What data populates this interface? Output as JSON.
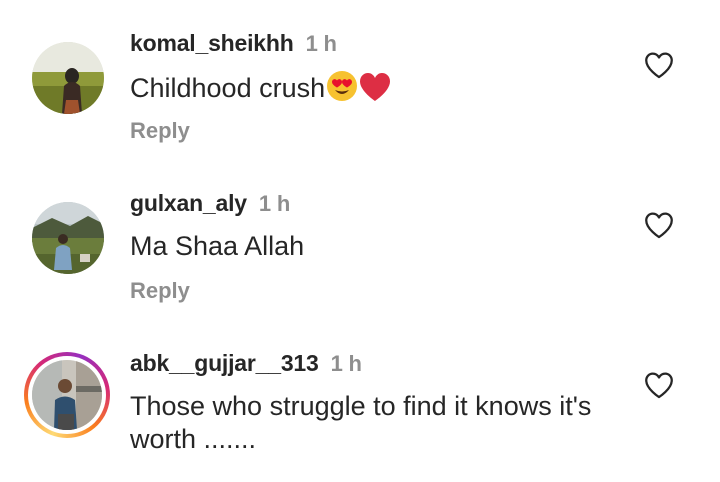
{
  "comments": [
    {
      "username": "komal_sheikhh",
      "time": "1 h",
      "text": "Childhood crush",
      "emojis": [
        "heart-eyes-emoji",
        "red-heart-emoji"
      ],
      "reply_label": "Reply",
      "liked": false,
      "has_story": false
    },
    {
      "username": "gulxan_aly",
      "time": "1 h",
      "text": "Ma Shaa Allah",
      "reply_label": "Reply",
      "liked": false,
      "has_story": false
    },
    {
      "username": "abk__gujjar__313",
      "time": "1 h",
      "text": "Those who struggle to find it knows it's worth .......",
      "liked": false,
      "has_story": true
    }
  ],
  "colors": {
    "primary_text": "#262626",
    "secondary_text": "#8e8e8e",
    "story_ring": [
      "#feda75",
      "#fa7e1e",
      "#d62976",
      "#962fbf"
    ]
  },
  "icons": {
    "like": "heart-outline-icon"
  }
}
